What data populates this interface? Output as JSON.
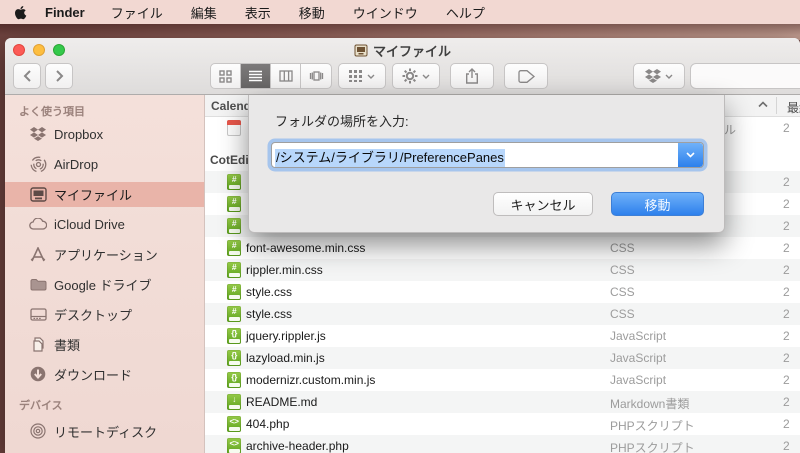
{
  "menu_bar": {
    "apple_icon": "apple-logo",
    "items": [
      {
        "label": "Finder"
      },
      {
        "label": "ファイル"
      },
      {
        "label": "編集"
      },
      {
        "label": "表示"
      },
      {
        "label": "移動"
      },
      {
        "label": "ウインドウ"
      },
      {
        "label": "ヘルプ"
      }
    ]
  },
  "window": {
    "title": "マイファイル"
  },
  "toolbar": {
    "buttons": [
      "back",
      "forward",
      "icon-view",
      "list-view",
      "column-view",
      "coverflow-view",
      "arrange",
      "action",
      "share",
      "tag",
      "dropbox",
      "search"
    ]
  },
  "sidebar": {
    "section1_header": "よく使う項目",
    "section2_header": "デバイス",
    "items": [
      {
        "label": "Dropbox"
      },
      {
        "label": "AirDrop"
      },
      {
        "label": "マイファイル",
        "selected": true
      },
      {
        "label": "iCloud Drive"
      },
      {
        "label": "アプリケーション"
      },
      {
        "label": "Google ドライブ"
      },
      {
        "label": "デスクトップ"
      },
      {
        "label": "書類"
      },
      {
        "label": "ダウンロード"
      },
      {
        "label": "リモートディスク"
      }
    ]
  },
  "list": {
    "header_group_fragment": "Calend",
    "date_column_header": "最終変更日",
    "group2_fragment": "CotEdi",
    "rows": [
      {
        "name": "",
        "kind": "ル",
        "date": "2"
      },
      {
        "name": "",
        "kind": "",
        "date": "2"
      },
      {
        "name": "",
        "kind": "",
        "date": "2"
      },
      {
        "name": "",
        "kind": "",
        "date": "2"
      },
      {
        "name": "font-awesome.min.css",
        "kind": "CSS",
        "date": "2"
      },
      {
        "name": "rippler.min.css",
        "kind": "CSS",
        "date": "2"
      },
      {
        "name": "style.css",
        "kind": "CSS",
        "date": "2"
      },
      {
        "name": "style.css",
        "kind": "CSS",
        "date": "2"
      },
      {
        "name": "jquery.rippler.js",
        "kind": "JavaScript",
        "date": "2"
      },
      {
        "name": "lazyload.min.js",
        "kind": "JavaScript",
        "date": "2"
      },
      {
        "name": "modernizr.custom.min.js",
        "kind": "JavaScript",
        "date": "2"
      },
      {
        "name": "README.md",
        "kind": "Markdown書類",
        "date": "2"
      },
      {
        "name": "404.php",
        "kind": "PHPスクリプト",
        "date": "2"
      },
      {
        "name": "archive-header.php",
        "kind": "PHPスクリプト",
        "date": "2"
      }
    ]
  },
  "dialog": {
    "prompt": "フォルダの場所を入力:",
    "path": "/システム/ライブラリ/PreferencePanes",
    "cancel": "キャンセル",
    "go": "移動"
  },
  "icons": {
    "css_glyph": "#",
    "js_glyph": "{}",
    "md_glyph": "↓",
    "php_glyph": "<>"
  }
}
